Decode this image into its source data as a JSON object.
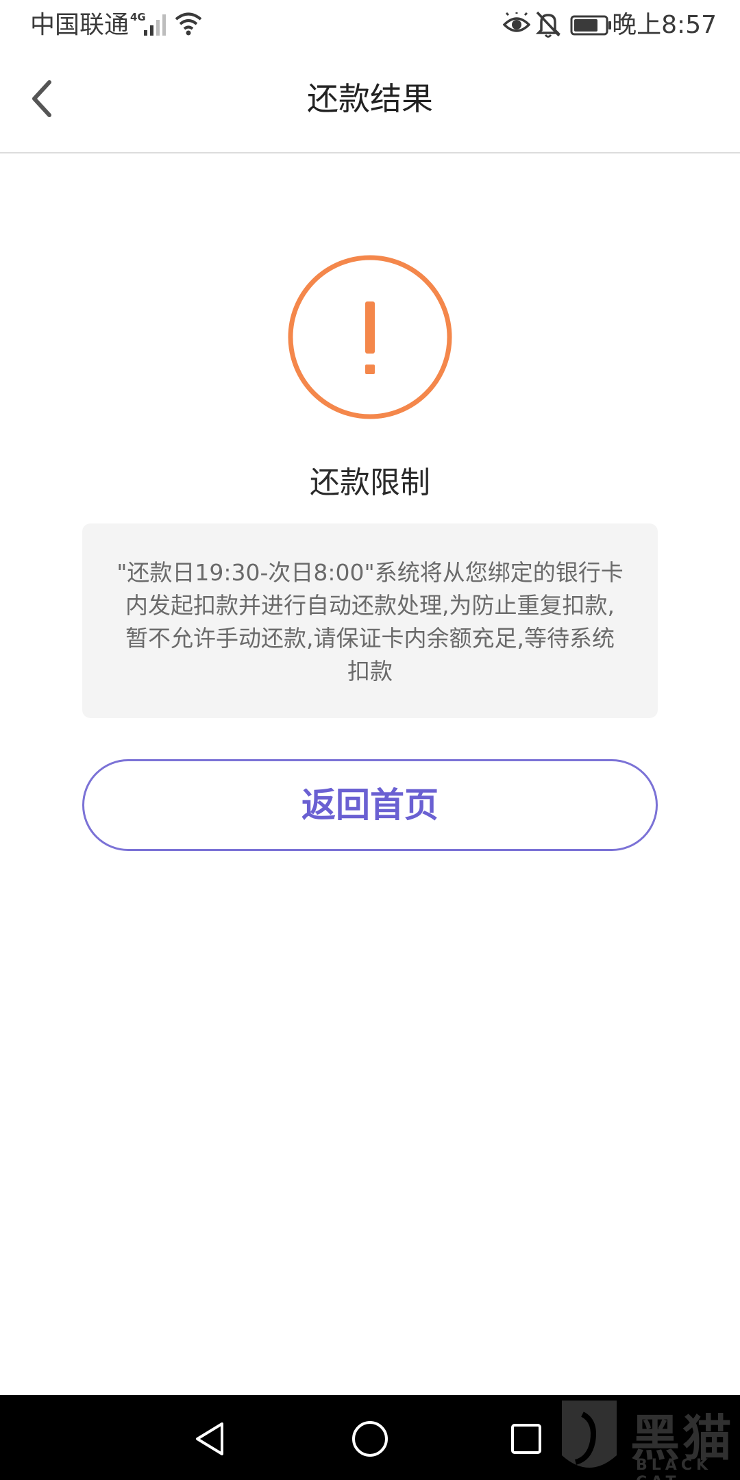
{
  "status_bar": {
    "carrier": "中国联通",
    "network_type": "4G",
    "time": "晚上8:57",
    "icons": [
      "signal-icon",
      "wifi-icon",
      "eye-icon",
      "bell-off-icon",
      "battery-icon"
    ]
  },
  "header": {
    "title": "还款结果",
    "back_icon": "chevron-left-icon"
  },
  "result": {
    "icon": "warning-icon",
    "icon_symbol": "!",
    "accent_color": "#f4874b",
    "title": "还款限制",
    "message": "\"还款日19:30-次日8:00\"系统将从您绑定的银行卡内发起扣款并进行自动还款处理,为防止重复扣款,暂不允许手动还款,请保证卡内余额充足,等待系统扣款"
  },
  "actions": {
    "home_button_label": "返回首页",
    "button_color": "#6a60d2"
  },
  "system_nav": {
    "icons": [
      "back-triangle-icon",
      "home-circle-icon",
      "recent-square-icon"
    ]
  },
  "watermark": {
    "text": "黑猫",
    "sub": "BLACK CAT"
  }
}
